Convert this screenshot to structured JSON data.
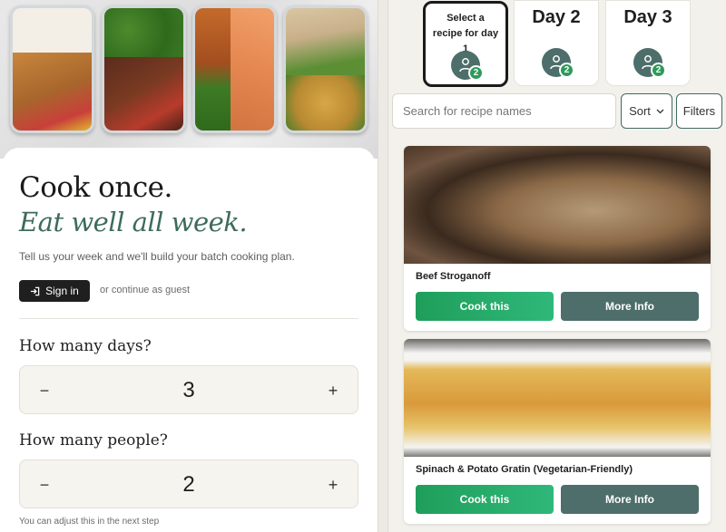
{
  "left": {
    "headline": "Cook once.",
    "headline_italic": "Eat well all week.",
    "subtitle": "Tell us your week and we'll build your batch cooking plan.",
    "signin_label": "Sign in",
    "guest_text": "or continue as guest",
    "days_question": "How many days?",
    "days_value": "3",
    "people_question": "How many people?",
    "people_value": "2",
    "minus_glyph": "−",
    "plus_glyph": "+",
    "hint": "You can adjust this in the next step"
  },
  "day_tabs": [
    {
      "label": "Select a recipe for day 1",
      "people": "2",
      "active": true
    },
    {
      "label": "Day 2",
      "people": "2",
      "active": false
    },
    {
      "label": "Day 3",
      "people": "2",
      "active": false
    }
  ],
  "search": {
    "placeholder": "Search for recipe names"
  },
  "sort_label": "Sort",
  "filters_label": "Filters",
  "recipes": [
    {
      "name": "Beef Stroganoff",
      "cook_label": "Cook this",
      "info_label": "More Info"
    },
    {
      "name": "Spinach & Potato Gratin (Vegetarian-Friendly)",
      "cook_label": "Cook this",
      "info_label": "More Info"
    }
  ],
  "icons": {
    "signin": "sign-in-icon",
    "avatar": "user-icon",
    "sort": "chevron-down-icon"
  },
  "colors": {
    "accent_green": "#2fb87a",
    "slate": "#4d6e6a",
    "italic_text": "#3d6b5c"
  }
}
